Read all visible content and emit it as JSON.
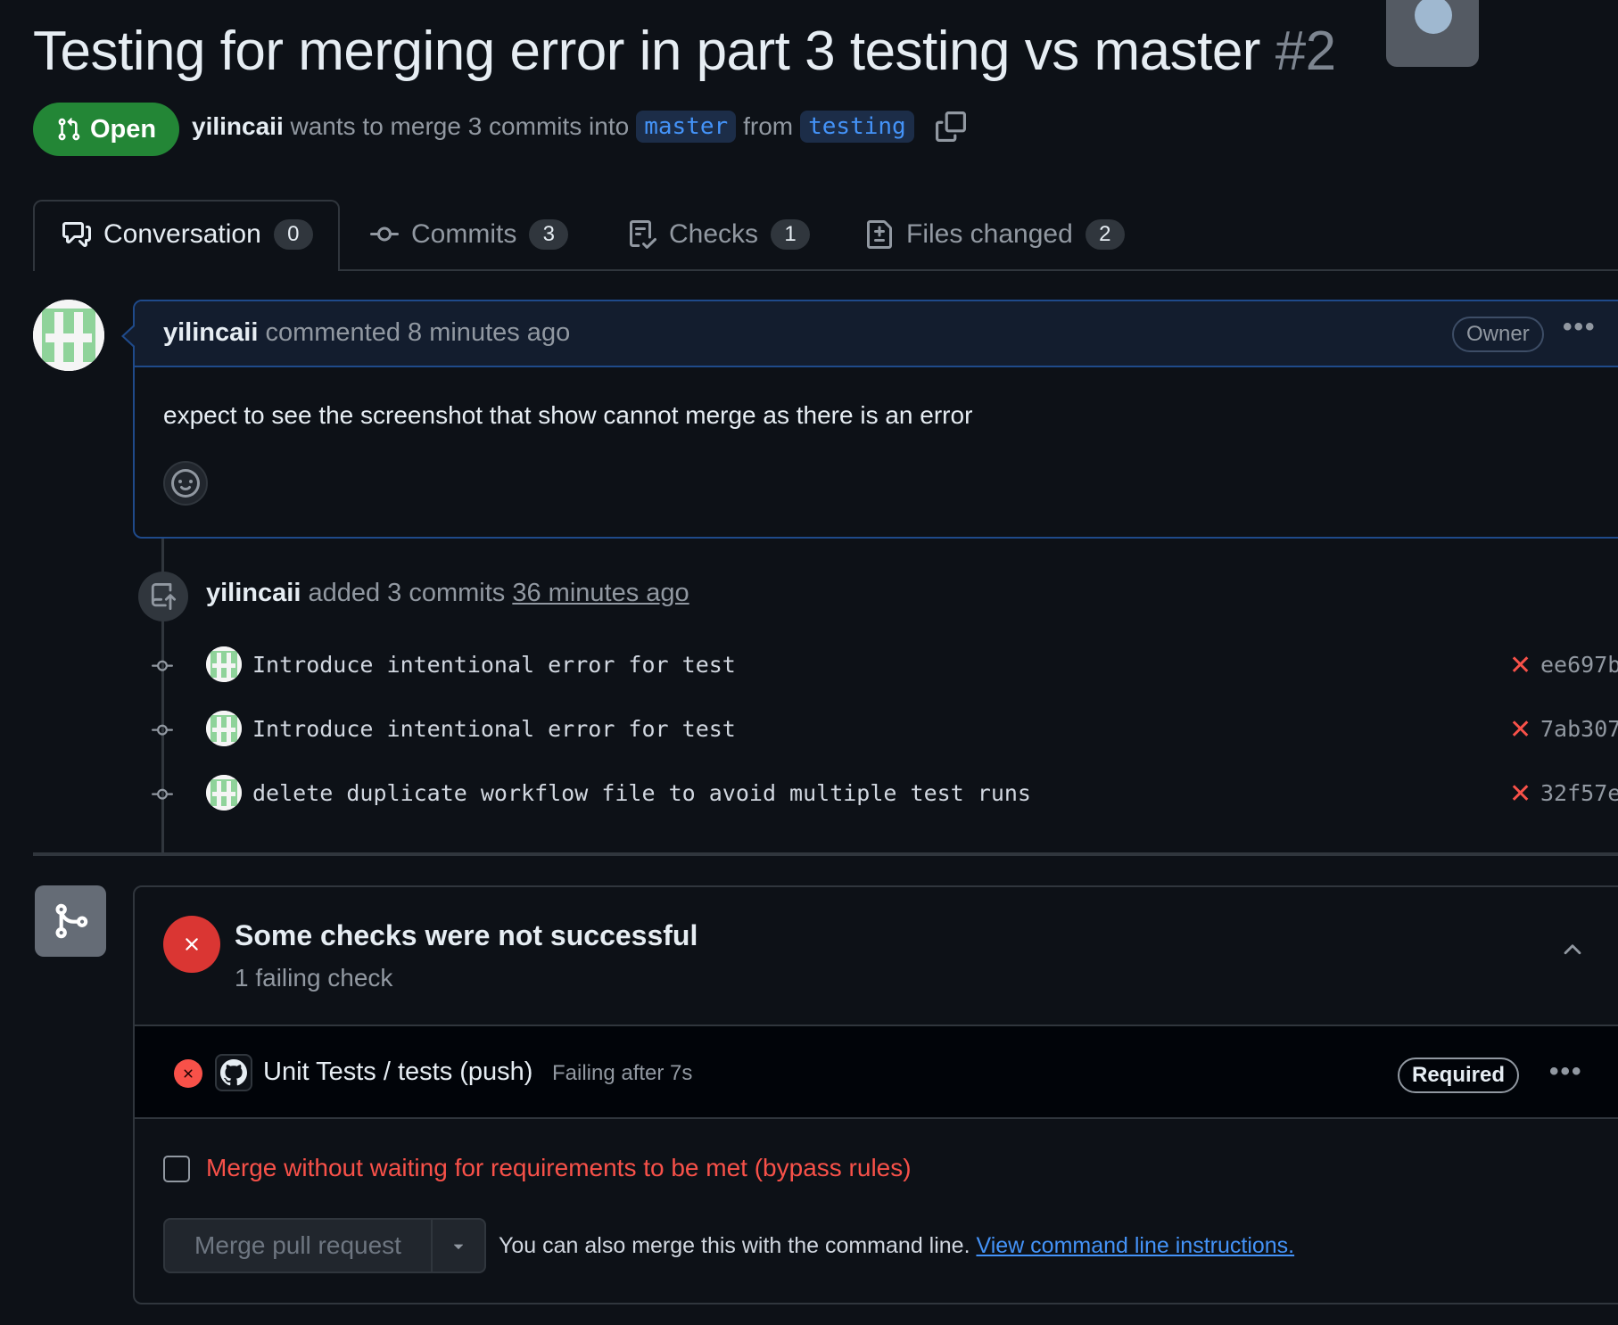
{
  "pr": {
    "title": "Testing for merging error in part 3 testing vs master",
    "number": "#2",
    "status_label": "Open",
    "author": "yilincaii",
    "merge_text": "wants to merge 3 commits into",
    "base_branch": "master",
    "from_text": "from",
    "head_branch": "testing"
  },
  "tabs": [
    {
      "label": "Conversation",
      "count": "0",
      "icon": "comment-discussion-icon"
    },
    {
      "label": "Commits",
      "count": "3",
      "icon": "git-commit-icon"
    },
    {
      "label": "Checks",
      "count": "1",
      "icon": "checklist-icon"
    },
    {
      "label": "Files changed",
      "count": "2",
      "icon": "file-diff-icon"
    }
  ],
  "comment": {
    "author": "yilincaii",
    "meta": "commented 8 minutes ago",
    "role_badge": "Owner",
    "body": "expect to see the screenshot that show cannot merge as there is an error"
  },
  "commits_event": {
    "author": "yilincaii",
    "text": "added 3 commits",
    "time": "36 minutes ago",
    "commits": [
      {
        "message": "Introduce intentional error for test",
        "sha": "ee697b"
      },
      {
        "message": "Introduce intentional error for test",
        "sha": "7ab307"
      },
      {
        "message": "delete duplicate workflow file to avoid multiple test runs",
        "sha": "32f57e"
      }
    ]
  },
  "merge_box": {
    "title": "Some checks were not successful",
    "subtitle": "1 failing check",
    "check_name": "Unit Tests / tests (push)",
    "check_status": "Failing after 7s",
    "required_badge": "Required",
    "bypass_label": "Merge without waiting for requirements to be met (bypass rules)",
    "merge_button_label": "Merge pull request",
    "cli_text": "You can also merge this with the command line.",
    "cli_link": "View command line instructions."
  },
  "colors": {
    "background": "#0d1117",
    "open_green": "#238636",
    "error_red": "#f85149",
    "link_blue": "#4493f8"
  }
}
